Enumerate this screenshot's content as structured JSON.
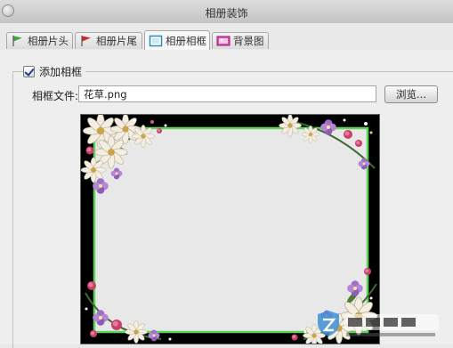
{
  "window": {
    "title": "相册装饰"
  },
  "tabs": [
    {
      "label": "相册片头",
      "icon": "green-flag-icon"
    },
    {
      "label": "相册片尾",
      "icon": "red-flag-icon"
    },
    {
      "label": "相册相框",
      "icon": "frame-icon",
      "active": true
    },
    {
      "label": "背景图",
      "icon": "picture-icon"
    }
  ],
  "frame": {
    "add_frame_label": "添加相框",
    "add_frame_checked": true,
    "file_label": "相框文件:",
    "file_value": "花草.png",
    "browse_label": "浏览..."
  },
  "colors": {
    "frame_border": "#5fd35a",
    "preview_bg": "#e8e8e8",
    "window_bg": "#e9e9e9"
  }
}
